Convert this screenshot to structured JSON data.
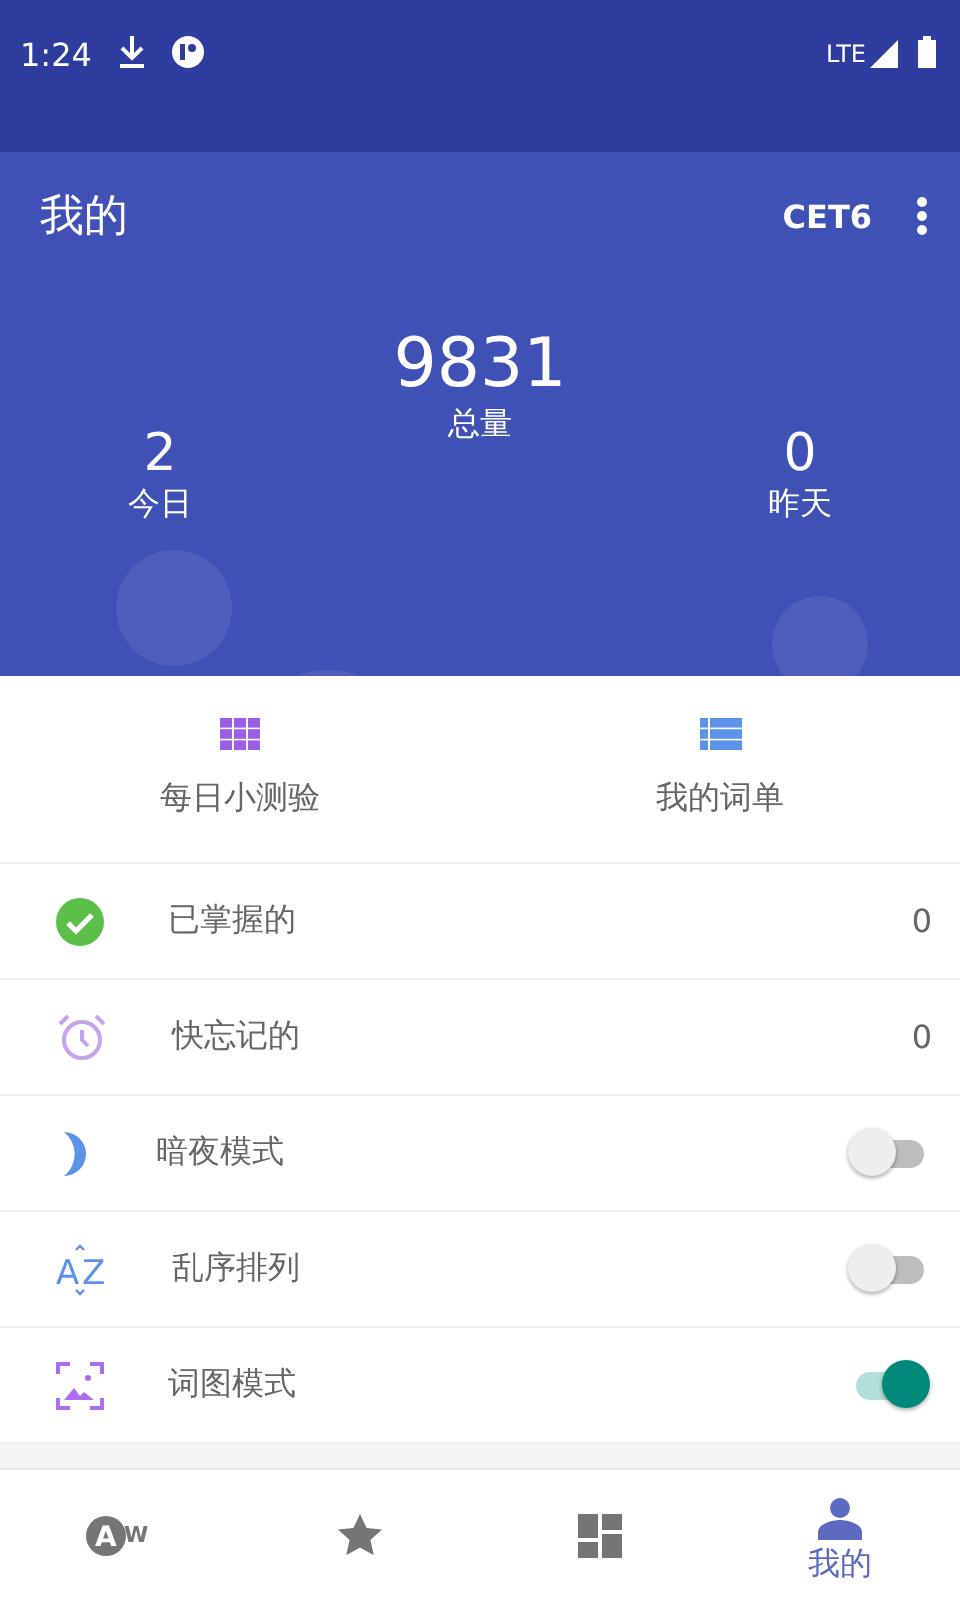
{
  "status_bar": {
    "time": "1:24",
    "network": "LTE"
  },
  "app_bar": {
    "title": "我的",
    "book": "CET6"
  },
  "stats": {
    "total": {
      "value": "9831",
      "label": "总量"
    },
    "today": {
      "value": "2",
      "label": "今日"
    },
    "yesterday": {
      "value": "0",
      "label": "昨天"
    }
  },
  "actions": [
    {
      "kind": "grid",
      "label": "每日小测验"
    },
    {
      "kind": "list",
      "label": "我的词单"
    }
  ],
  "rows": [
    {
      "kind": "count",
      "label": "已掌握的",
      "count": "0"
    },
    {
      "kind": "count",
      "label": "快忘记的",
      "count": "0"
    },
    {
      "kind": "switch",
      "label": "暗夜模式",
      "on": false
    },
    {
      "kind": "switch",
      "label": "乱序排列",
      "on": false,
      "letters": [
        "A",
        "Z"
      ]
    },
    {
      "kind": "switch",
      "label": "词图模式",
      "on": true
    }
  ],
  "nav": [
    {
      "kind": "aw",
      "selected": false,
      "letters": [
        "A",
        "W"
      ]
    },
    {
      "kind": "star",
      "selected": false
    },
    {
      "kind": "dashboard",
      "selected": false
    },
    {
      "kind": "person",
      "selected": true,
      "label": "我的"
    }
  ]
}
